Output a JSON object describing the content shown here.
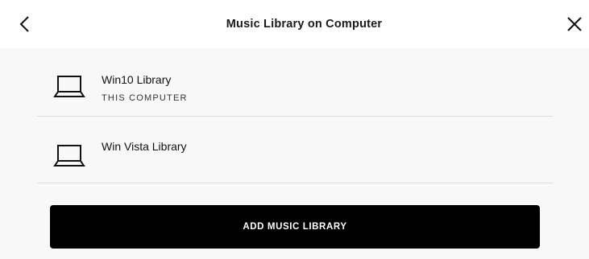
{
  "header": {
    "title": "Music Library on Computer",
    "back_icon": "chevron-left-icon",
    "close_icon": "close-icon"
  },
  "libraries": [
    {
      "name": "Win10 Library",
      "subtitle": "THIS COMPUTER",
      "icon": "laptop-icon"
    },
    {
      "name": "Win Vista Library",
      "subtitle": "",
      "icon": "laptop-icon"
    }
  ],
  "actions": {
    "add_label": "ADD MUSIC LIBRARY"
  },
  "colors": {
    "header_bg": "#ffffff",
    "page_bg": "#f8f8f8",
    "divider": "#dcdcdc",
    "button_bg": "#000000",
    "button_text": "#ffffff"
  }
}
